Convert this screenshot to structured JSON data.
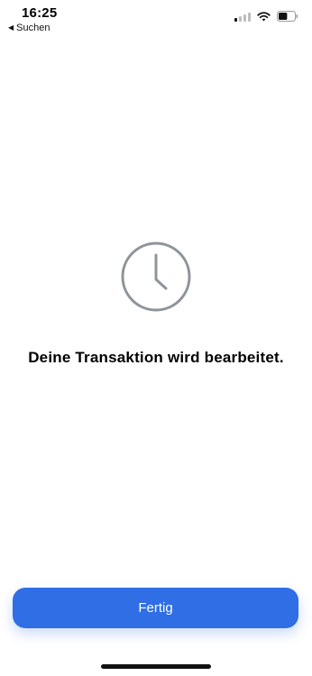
{
  "status_bar": {
    "time": "16:25",
    "back_label": "Suchen",
    "signal_bars_active": 1,
    "signal_bars_total": 4,
    "battery_level": 0.55
  },
  "main": {
    "icon": "clock-icon",
    "message": "Deine Transaktion wird bearbeitet."
  },
  "footer": {
    "done_label": "Fertig"
  },
  "colors": {
    "accent": "#2f6ee5",
    "icon_gray": "#8e9499",
    "background": "#ffffff"
  }
}
